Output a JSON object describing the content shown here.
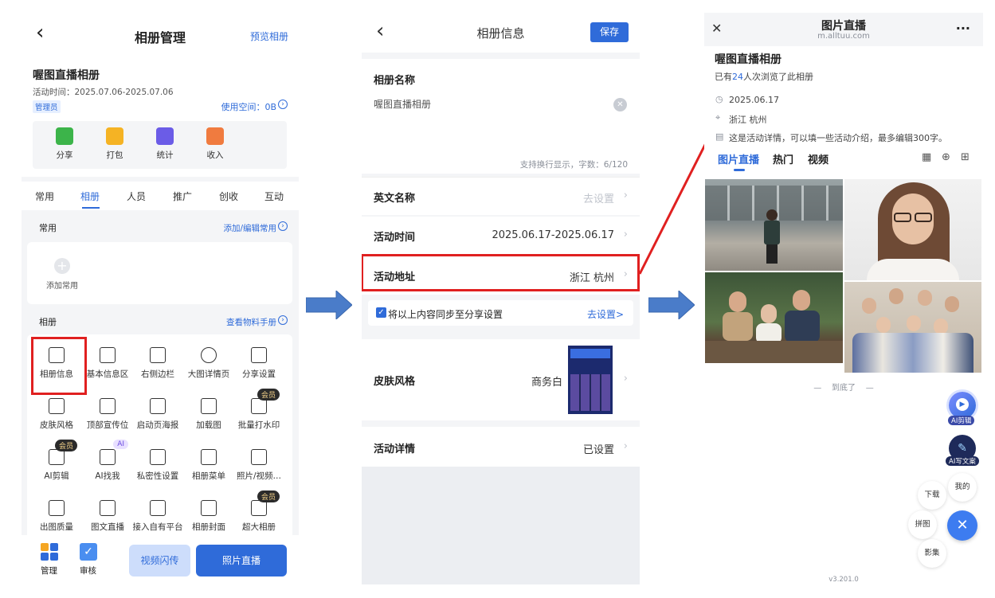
{
  "panel1": {
    "back": "‹",
    "title": "相册管理",
    "preview": "预览相册",
    "album_name": "喔图直播相册",
    "activity_time": "活动时间：2025.07.06-2025.07.06",
    "role_badge": "管理员",
    "used_space": "使用空间：0B",
    "quick_actions": [
      {
        "label": "分享",
        "color": "#3cb44a"
      },
      {
        "label": "打包",
        "color": "#f5b324"
      },
      {
        "label": "统计",
        "color": "#6b5ce7"
      },
      {
        "label": "收入",
        "color": "#f07b3f"
      }
    ],
    "tabs": [
      "常用",
      "相册",
      "人员",
      "推广",
      "创收",
      "互动"
    ],
    "active_tab": 1,
    "common_section": {
      "title": "常用",
      "link": "添加/编辑常用",
      "add_label": "添加常用"
    },
    "album_section": {
      "title": "相册",
      "link": "查看物料手册"
    },
    "grid_items": [
      {
        "label": "相册信息",
        "icon": "album-info-icon"
      },
      {
        "label": "基本信息区",
        "icon": "basic-info-icon"
      },
      {
        "label": "右侧边栏",
        "icon": "right-sidebar-icon"
      },
      {
        "label": "大图详情页",
        "icon": "info-circle-icon"
      },
      {
        "label": "分享设置",
        "icon": "share-settings-icon"
      },
      {
        "label": "皮肤风格",
        "icon": "tshirt-icon"
      },
      {
        "label": "顶部宣传位",
        "icon": "top-banner-icon"
      },
      {
        "label": "启动页海报",
        "icon": "poster-icon"
      },
      {
        "label": "加载图",
        "icon": "loading-icon"
      },
      {
        "label": "批量打水印",
        "icon": "watermark-icon",
        "badge": "会员"
      },
      {
        "label": "AI剪辑",
        "icon": "ai-clip-icon",
        "badge": "会员"
      },
      {
        "label": "AI找我",
        "icon": "ai-find-icon",
        "badge": "AI"
      },
      {
        "label": "私密性设置",
        "icon": "privacy-icon"
      },
      {
        "label": "相册菜单",
        "icon": "menu-icon"
      },
      {
        "label": "照片/视频…",
        "icon": "photo-video-icon"
      },
      {
        "label": "出图质量",
        "icon": "hd-icon"
      },
      {
        "label": "图文直播",
        "icon": "image-text-icon"
      },
      {
        "label": "接入自有平台",
        "icon": "platform-icon"
      },
      {
        "label": "相册封面",
        "icon": "cover-icon"
      },
      {
        "label": "超大相册",
        "icon": "large-album-icon",
        "badge": "会员"
      }
    ],
    "bottom": {
      "manage": "管理",
      "review": "审核",
      "video_flash": "视频闪传",
      "photo_live": "照片直播"
    }
  },
  "panel2": {
    "back": "‹",
    "title": "相册信息",
    "save": "保存",
    "name_label": "相册名称",
    "name_value": "喔图直播相册",
    "name_hint": "支持换行显示，字数：6/120",
    "en_name_label": "英文名称",
    "en_name_value": "去设置",
    "time_label": "活动时间",
    "time_value": "2025.06.17-2025.06.17",
    "address_label": "活动地址",
    "address_value": "浙江 杭州",
    "sync_text": "将以上内容同步至分享设置",
    "sync_link": "去设置>",
    "skin_label": "皮肤风格",
    "skin_value": "商务白",
    "detail_label": "活动详情",
    "detail_value": "已设置"
  },
  "panel3": {
    "close": "✕",
    "title": "图片直播",
    "url": "m.alltuu.com",
    "more": "···",
    "album_name": "喔图直播相册",
    "views_prefix": "已有",
    "views_count": "24",
    "views_suffix": "人次浏览了此相册",
    "date": "2025.06.17",
    "location": "浙江 杭州",
    "detail": "这是活动详情，可以填一些活动介绍，最多编辑300字。",
    "tabs": [
      "图片直播",
      "热门",
      "视频"
    ],
    "end_text": "—    到底了    —",
    "fab": {
      "ai_clip": "AI剪辑",
      "ai_copy": "AI写文案",
      "mine": "我的",
      "download": "下载",
      "collage": "拼图",
      "shadow": "影集"
    },
    "version": "v3.201.0"
  },
  "colors": {
    "accent": "#2f6bd9",
    "highlight": "#e02020",
    "arrow": "#4a7cc9"
  }
}
